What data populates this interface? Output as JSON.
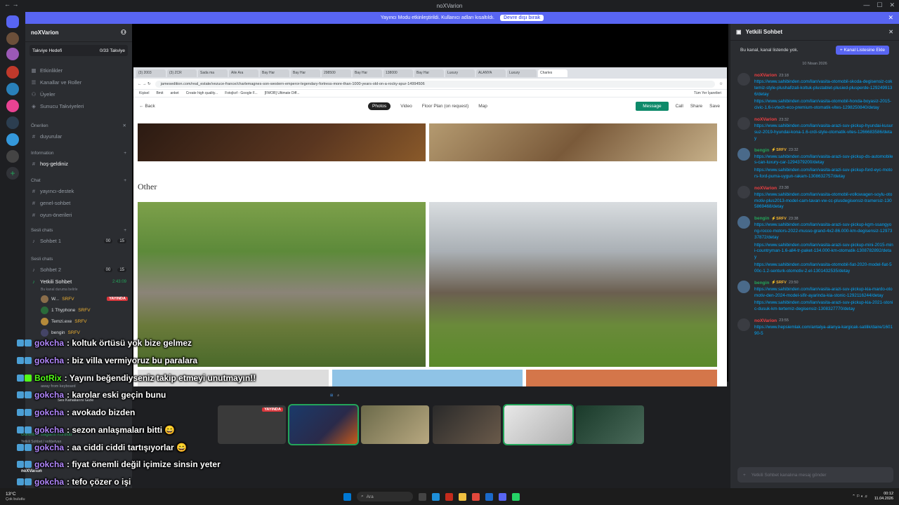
{
  "window": {
    "title": "noXVarion",
    "min": "—",
    "max": "☐",
    "close": "✕"
  },
  "banner": {
    "text": "Yayıncı Modu etkinleştirildi. Kullanıcı adları kısaltıldı.",
    "button": "Devre dışı bırak"
  },
  "server": {
    "name": "noXVarion",
    "boost_label": "Takviye Hedefi",
    "boost_value": "0/33 Takviye",
    "menu": [
      "Etkinlikler",
      "Kanallar ve Roller",
      "Üyeler",
      "Sunucu Takviyeleri"
    ],
    "cat_oneriler": "Önerilen",
    "ch_duyurular": "duyurular",
    "cat_information": "Information",
    "ch_hosgeldiniz": "hoş-geldiniz",
    "cat_chat": "Chat",
    "chat_channels": [
      "yayıncı-destek",
      "genel-sohbet",
      "oyun-önerileri"
    ],
    "cat_voice1": "Sesli chats",
    "voice1": "Sohbet 1",
    "voice1_tag": "00",
    "voice1_count": "15",
    "cat_voice2": "Sesli chats",
    "voice2": "Sohbet 2",
    "voice2_tag": "00",
    "voice2_count": "15",
    "voice_active": "Yetkili Sohbet",
    "voice_active_time": "2:43:09",
    "voice_active_sub": "Bu kanal duruma belirle",
    "voice_users": [
      {
        "name": "W...",
        "badge": "SRFV",
        "live": "YAYINDA"
      },
      {
        "name": "1 Thyphone",
        "badge": "SRFV",
        "live": ""
      },
      {
        "name": "Temzi.exe",
        "badge": "SRFV",
        "live": ""
      },
      {
        "name": "bengin",
        "badge": "SRFV",
        "live": ""
      }
    ],
    "away": "away from keyboard",
    "voice_status": "Ses Kanallarını Gizle",
    "connection": "Görüntülü Bağlantı Kuruldu",
    "connection_sub": "Yetkili Sohbet / sohbetyan",
    "user": "noXVarion"
  },
  "browser": {
    "tabs": [
      "(3) 2003",
      "(3) ZCR",
      "Sada ma",
      "Aile Ara",
      "Bay Har",
      "Bay Har",
      "298500",
      "Bay Har",
      "138000",
      "Bay Har",
      "Luxury",
      "ALANYA",
      "Luxury",
      "Charles"
    ],
    "url": "jamesedition.com/real_estate/vezuce-france/charlemagnes-son-western-emperor-legendary-fortress-more-than-1000-years-old-on-a-rocky-spur-14994506",
    "bookmarks": [
      "Kişisel",
      "Bmit",
      "anket",
      "Create high quality...",
      "Fotojkof - Google F...",
      "[FMOB] Ultimate Diff..."
    ],
    "bookmarks_right": "Tüm Yer İşaretleri",
    "back": "Back",
    "site_tabs": [
      "Photos",
      "Video",
      "Floor Plan (on request)",
      "Map"
    ],
    "message": "Message",
    "call": "Call",
    "share": "Share",
    "save": "Save",
    "section": "Other",
    "taskbar_time": "00:12",
    "taskbar_date": "11.04.2026"
  },
  "chat_overlay": [
    {
      "user": "gokcha",
      "text": ": koltuk örtüsü yok bize gelmez"
    },
    {
      "user": "gokcha",
      "text": ": biz villa vermiyoruz bu paralara"
    },
    {
      "user": "BotRix",
      "text": ": Yayını beğendiyseniz takip etmeyi unutmayın!!"
    },
    {
      "user": "gokcha",
      "text": ": karolar eski geçin bunu"
    },
    {
      "user": "gokcha",
      "text": ": avokado bizden"
    },
    {
      "user": "gokcha",
      "text": ": sezon anlaşmaları bitti 😄"
    },
    {
      "user": "gokcha",
      "text": ": aa ciddi ciddi tartışıyorlar 😄"
    },
    {
      "user": "gokcha",
      "text": ": fiyat önemli değil içimize sinsin yeter"
    },
    {
      "user": "gokcha",
      "text": ": tefo çözer o işi"
    }
  ],
  "video_tiles": {
    "live_label": "YAYINDA"
  },
  "right_panel": {
    "title": "Yetkili Sohbet",
    "notice": "Bu kanal, kanal listende yok.",
    "add_button": "Kanal Listesine Ekle",
    "date": "10 Nisan 2026",
    "messages": [
      {
        "user": "noXVarion",
        "type": "red",
        "badge": "",
        "time": "23:18",
        "links": [
          "https://www.sahibinden.com/ilan/vasita-otomobil-skoda-degisensiz-coktemiz-style-plushafizali-koltuk-plustablet-plusied-plusperde-1292499136/detay",
          "https://www.sahibinden.com/ilan/vasita-otomobil-honda-boyasiz-2015-civic-1.6-i-vtech-eco-premium-otomatik-vites-1298250840/detay"
        ]
      },
      {
        "user": "noXVarion",
        "type": "red",
        "badge": "",
        "time": "23:32",
        "links": [
          "https://www.sahibinden.com/ilan/vasita-arazi-suv-pickup-hyundai-kusursuz-2019-hyundai-kona-1.6-crdi-style-otomatik-vites-1266683586/detay"
        ]
      },
      {
        "user": "bengin",
        "type": "green",
        "badge": "⚡SRFV",
        "time": "23:32",
        "links": [
          "https://www.sahibinden.com/ilan/vasita-arazi-suv-pickup-ds-automobiles-can-luxury-car-1294379200/detay",
          "https://www.sahibinden.com/ilan/vasita-arazi-suv-pickup-ford-eyc-motors-ford-puma-uygun-rakam-1308632757/detay"
        ]
      },
      {
        "user": "noXVarion",
        "type": "red",
        "badge": "",
        "time": "23:38",
        "links": [
          "https://www.sahibinden.com/ilan/vasita-otomobil-volkswagen-soylu-otomotiv-plus2013-model-cam-tavan-vw-cc-plusdegisensiz-tramersiz-1305869468/detay"
        ]
      },
      {
        "user": "bengin",
        "type": "green",
        "badge": "⚡SRFV",
        "time": "23:38",
        "links": [
          "https://www.sahibinden.com/ilan/vasita-arazi-suv-pickup-kgm-ssangyong-rocco-motors-2022-musso-grand-4x2-86.000-km-degisensiz-1297337872/detay",
          "https://www.sahibinden.com/ilan/vasita-arazi-suv-pickup-mini-2015-mini-countryman-1.6-all4-tr-paket-134.000-km-otomatik-1308782892/detay",
          "https://www.sahibinden.com/ilan/vasita-otomobil-fiat-2020-model-fiat-500c-1.2-senturk-otomotiv-2.el-1301432535/detay"
        ]
      },
      {
        "user": "bengin",
        "type": "green",
        "badge": "⚡SRFV",
        "time": "23:50",
        "links": [
          "https://www.sahibinden.com/ilan/vasita-arazi-suv-pickup-kia-mardo-otomotiv-den-2024-model-sifir-ayarinda-kia-stonic-1292116244/detay",
          "https://www.sahibinden.com/ilan/vasita-arazi-suv-pickup-kia-2021-stonic-dusuk-km-tertemiz-degisensiz-1308327770/detay"
        ]
      },
      {
        "user": "noXVarion",
        "type": "red",
        "badge": "",
        "time": "23:55",
        "links": [
          "https://www.hepsiemlak.com/antalya-alanya-kargicak-satilik/daire/160190-5"
        ]
      }
    ],
    "input_placeholder": "Yetkili Sohbet kanalına mesaj gönder"
  },
  "taskbar": {
    "weather": "13°C",
    "weather_sub": "Çok bulutlu",
    "search": "Ara",
    "time": "00:12",
    "date": "11.04.2026"
  }
}
